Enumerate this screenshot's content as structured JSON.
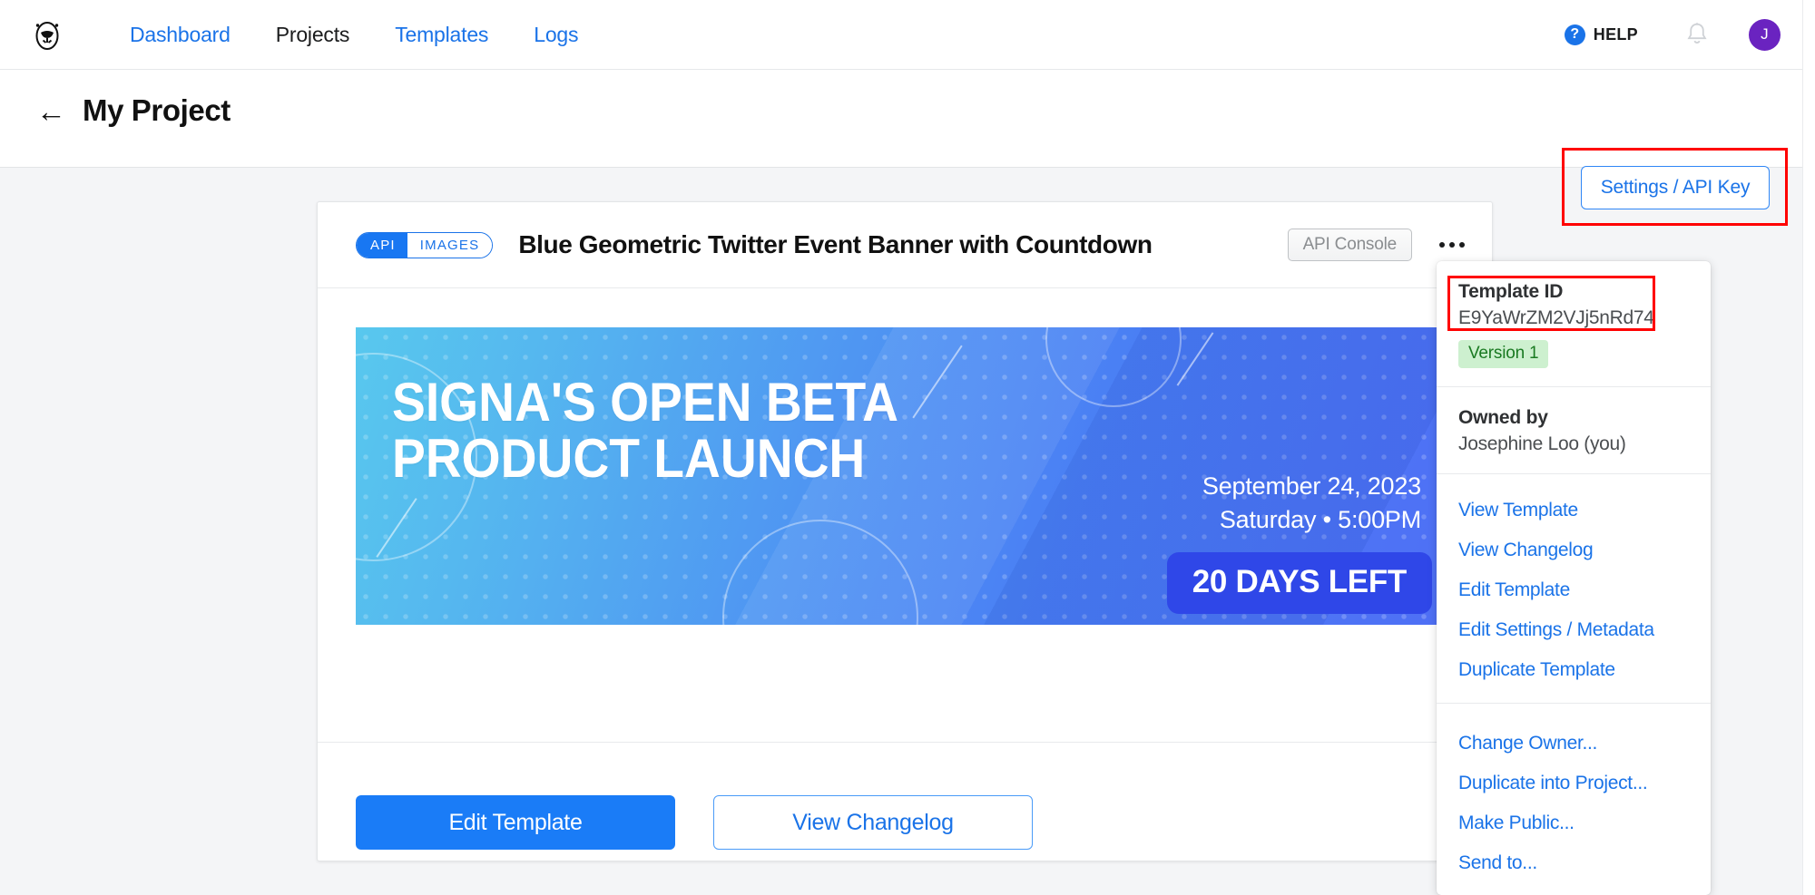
{
  "nav": {
    "logo_icon": "owl-logo-icon",
    "links": [
      {
        "label": "Dashboard",
        "active": false
      },
      {
        "label": "Projects",
        "active": true
      },
      {
        "label": "Templates",
        "active": false
      },
      {
        "label": "Logs",
        "active": false
      }
    ],
    "help_label": "HELP",
    "help_icon": "question-mark-icon",
    "bell_icon": "notification-bell-icon",
    "avatar_initial": "J"
  },
  "project_header": {
    "back_icon": "arrow-left-icon",
    "title": "My Project",
    "settings_button": "Settings / API Key"
  },
  "card": {
    "badge": {
      "left": "API",
      "right": "IMAGES"
    },
    "title": "Blue Geometric Twitter Event Banner with Countdown",
    "api_console_button": "API Console",
    "overflow_icon": "ellipsis-icon",
    "banner": {
      "headline_line1": "SIGNA'S OPEN BETA",
      "headline_line2": "PRODUCT LAUNCH",
      "date": "September 24, 2023",
      "time": "Saturday • 5:00PM",
      "countdown": "20 DAYS LEFT"
    },
    "actions": {
      "primary": "Edit Template",
      "secondary": "View Changelog"
    }
  },
  "dropdown": {
    "template_id_label": "Template ID",
    "template_id_value": "E9YaWrZM2VJj5nRd74",
    "version_badge": "Version 1",
    "owner_label": "Owned by",
    "owner_value": "Josephine Loo (you)",
    "menu_primary": [
      "View Template",
      "View Changelog",
      "Edit Template",
      "Edit Settings / Metadata",
      "Duplicate Template"
    ],
    "menu_secondary": [
      "Change Owner...",
      "Duplicate into Project...",
      "Make Public...",
      "Send to..."
    ]
  },
  "colors": {
    "accent_blue": "#1a73e8",
    "primary_button": "#1a7cf7",
    "annotation_red": "#ff0000",
    "version_green_bg": "#cdf0cf",
    "version_green_text": "#1a7a22",
    "avatar_purple": "#6a23c0",
    "countdown_badge": "#2f47e8"
  }
}
